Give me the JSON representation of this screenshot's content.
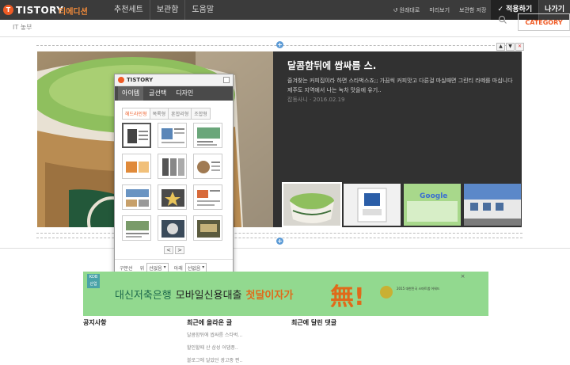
{
  "topbar": {
    "logo_letter": "T",
    "logo_text": "TISTORY",
    "edition": "티에디션",
    "nav": [
      "추천세트",
      "보관함",
      "도움말"
    ],
    "links": [
      "원래대로",
      "미리보기",
      "보관함 저장"
    ],
    "apply": "적용하기",
    "exit": "나가기"
  },
  "header": {
    "blog_name": "IT 놓부",
    "category": "CATEGORY"
  },
  "featured": {
    "title": "달콤함뒤에 쌉싸름 스.",
    "description": "즐겨찾는 커피집이라 하면 스타벅스죠;; 가끔씩 커피맛고 다른걸 마실때면 그린티 라떼를 마십니다 제주도 지역에서 나는 녹차 맛을에 유기..",
    "meta": "잡동사니 · 2016.02.19",
    "thumb_labels": [
      "",
      "",
      "Google",
      ""
    ]
  },
  "panel": {
    "logo_text": "TISTORY",
    "tabs": [
      "아이템",
      "글선택",
      "디자인"
    ],
    "subtabs": [
      "헤드라인형",
      "목록형",
      "혼합리형",
      "조합형"
    ],
    "pager": [
      "<",
      ">"
    ],
    "bottom": {
      "label": "구분선",
      "top_label": "위",
      "top_value": "선없음",
      "bottom_label": "아래",
      "bottom_value": "선없음"
    }
  },
  "ad": {
    "badge": "KDB 산업",
    "part1": "대신저축은행",
    "part2": "모바일신용대출",
    "part3": "첫달이자가",
    "excl": "無!",
    "award": "2015 대한민국 스마트앱 어워드",
    "close": "×"
  },
  "footer": {
    "notice_title": "공지사항",
    "recent_posts_title": "최근에 올라온 글",
    "recent_comments_title": "최근에 달린 댓글",
    "recent_posts": [
      "달콤함뒤에 쌉싸름 스타벅...",
      "할인할때 산 삼성 어댑풍..",
      "블로그에 달았던 광고중 편.."
    ]
  },
  "colors": {
    "accent": "#ef5b25",
    "topbar": "#3b3b3b",
    "module_bg": "#313131",
    "ad_bg": "#92d98f"
  }
}
